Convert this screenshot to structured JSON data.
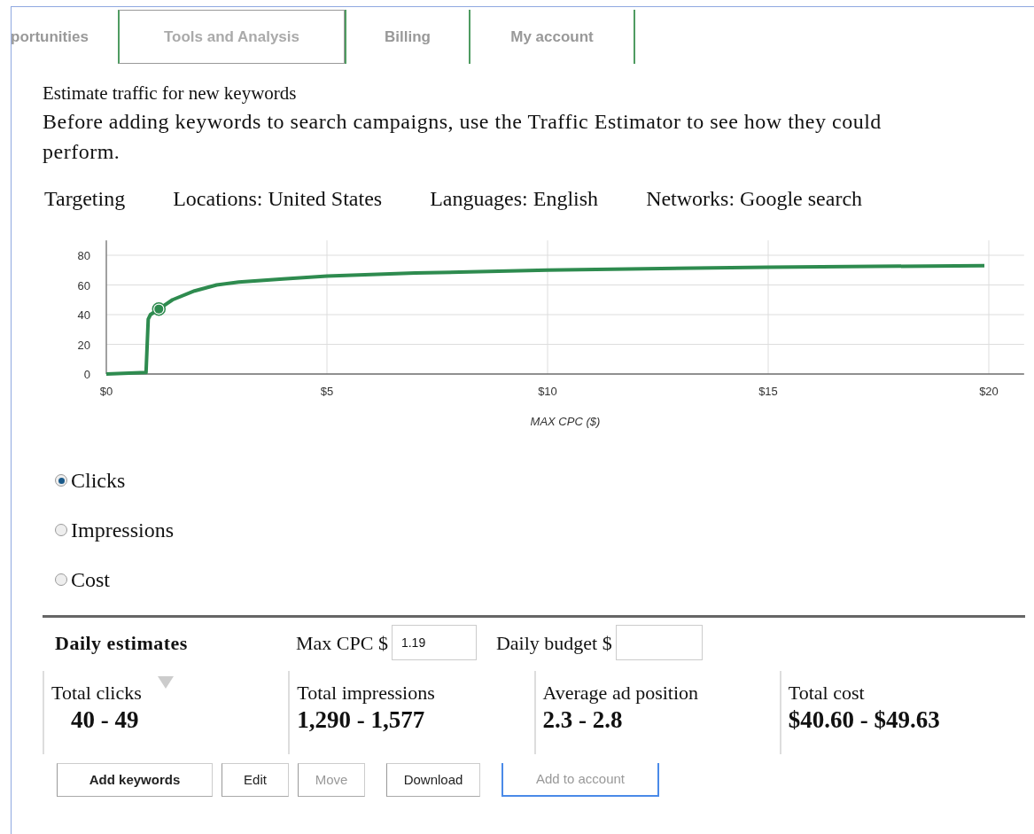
{
  "tabs": [
    {
      "label": "portunities",
      "selected": false
    },
    {
      "label": "Tools and Analysis",
      "selected": true
    },
    {
      "label": "Billing",
      "selected": false
    },
    {
      "label": "My account",
      "selected": false
    }
  ],
  "heading": "Estimate traffic for new keywords",
  "intro": "Before adding keywords to search campaigns, use the Traffic Estimator to see how they could perform.",
  "targeting": [
    "Targeting",
    "Locations: United States",
    "Languages: English",
    "Networks: Google search"
  ],
  "chart_data": {
    "type": "line",
    "xlabel": "MAX CPC ($)",
    "xlim": [
      0,
      20.8
    ],
    "ylim": [
      0,
      90
    ],
    "grid": true,
    "xticks": [
      {
        "value": 0,
        "label": "$0"
      },
      {
        "value": 5,
        "label": "$5"
      },
      {
        "value": 10,
        "label": "$10"
      },
      {
        "value": 15,
        "label": "$15"
      },
      {
        "value": 20,
        "label": "$20"
      }
    ],
    "yticks": [
      0,
      20,
      40,
      60,
      80
    ],
    "x": [
      0,
      0.9,
      0.95,
      1,
      1.2,
      1.5,
      2,
      2.5,
      3,
      4,
      5,
      7,
      10,
      15,
      19.9
    ],
    "series": [
      {
        "color": "#2e8b4f",
        "values": [
          0,
          1,
          37,
          40,
          44,
          50,
          56,
          60,
          62,
          64,
          66,
          68,
          70,
          72,
          73
        ]
      }
    ]
  },
  "metrics": [
    {
      "label": "Clicks",
      "selected": true
    },
    {
      "label": "Impressions",
      "selected": false
    },
    {
      "label": "Cost",
      "selected": false
    }
  ],
  "estimates": {
    "title": "Daily estimates",
    "max_cpc_label": "Max CPC $",
    "max_cpc": "1.19",
    "budget_label": "Daily budget $"
  },
  "totals": [
    {
      "label": "Total clicks",
      "value": "40 - 49"
    },
    {
      "label": "Total impressions",
      "value": "1,290 - 1,577"
    },
    {
      "label": "Average ad position",
      "value": "2.3 - 2.8"
    },
    {
      "label": "Total cost",
      "value": "$40.60 - $49.63"
    }
  ],
  "buttons": [
    {
      "label": "Add keywords",
      "disabled": false,
      "kind": "primary"
    },
    {
      "label": "Edit",
      "disabled": false,
      "kind": "plain"
    },
    {
      "label": "Move",
      "disabled": true,
      "kind": "plain"
    },
    {
      "label": "Download",
      "disabled": false,
      "kind": "plain"
    },
    {
      "label": "Add to account",
      "disabled": true,
      "kind": "focused"
    }
  ]
}
